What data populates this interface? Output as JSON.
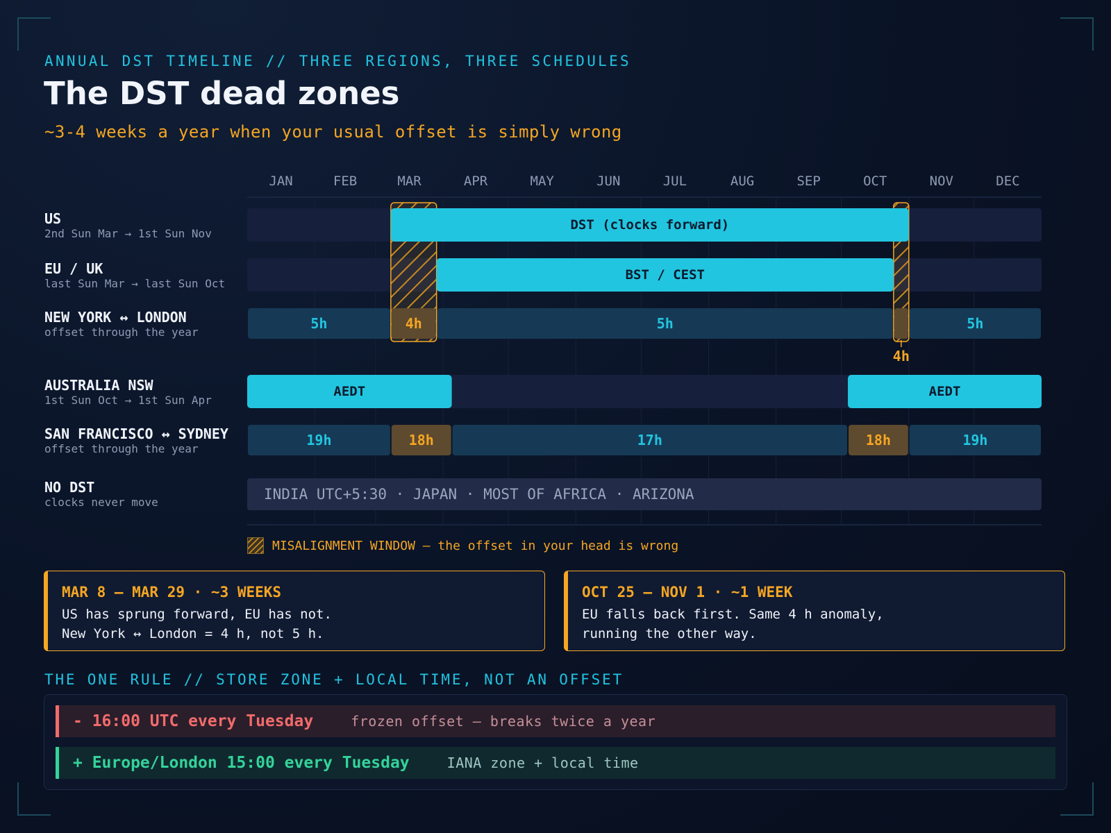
{
  "header": {
    "kicker": "ANNUAL DST TIMELINE // THREE REGIONS, THREE SCHEDULES",
    "title": "The DST dead zones",
    "subtitle": "~3-4 weeks a year when your usual offset is simply wrong"
  },
  "months": [
    "JAN",
    "FEB",
    "MAR",
    "APR",
    "MAY",
    "JUN",
    "JUL",
    "AUG",
    "SEP",
    "OCT",
    "NOV",
    "DEC"
  ],
  "rows": [
    {
      "name": "US",
      "desc": "2nd Sun Mar → 1st Sun Nov"
    },
    {
      "name": "EU / UK",
      "desc": "last Sun Mar → last Sun Oct"
    },
    {
      "name": "NEW YORK ↔ LONDON",
      "desc": "offset through the year"
    },
    {
      "name": "AUSTRALIA NSW",
      "desc": "1st Sun Oct → 1st Sun Apr"
    },
    {
      "name": "SAN FRANCISCO ↔ SYDNEY",
      "desc": "offset through the year"
    },
    {
      "name": "NO DST",
      "desc": "clocks never move"
    }
  ],
  "bars": {
    "us": {
      "label": "DST (clocks forward)",
      "start": "Mar 8",
      "end": "Nov 1"
    },
    "eu": {
      "label": "BST / CEST",
      "start": "Mar 29",
      "end": "Oct 25"
    },
    "aus": {
      "label": "AEDT",
      "periods": [
        {
          "start": "Jan 1",
          "end": "Apr 5"
        },
        {
          "start": "Oct 4",
          "end": "Dec 31"
        }
      ]
    },
    "nodst": {
      "label": "INDIA UTC+5:30 · JAPAN · MOST OF AFRICA · ARIZONA"
    }
  },
  "ny_london_offsets": [
    {
      "label": "5h",
      "start": "Jan 1",
      "end": "Mar 8",
      "anomaly": false
    },
    {
      "label": "4h",
      "start": "Mar 8",
      "end": "Mar 29",
      "anomaly": true
    },
    {
      "label": "5h",
      "start": "Mar 29",
      "end": "Oct 25",
      "anomaly": false
    },
    {
      "label": "4h",
      "start": "Oct 25",
      "end": "Nov 1",
      "anomaly": true
    },
    {
      "label": "5h",
      "start": "Nov 1",
      "end": "Dec 31",
      "anomaly": false
    }
  ],
  "sf_sydney_offsets": [
    {
      "label": "19h",
      "start": "Jan 1",
      "end": "Mar 8",
      "anomaly": false
    },
    {
      "label": "18h",
      "start": "Mar 8",
      "end": "Apr 5",
      "anomaly": true
    },
    {
      "label": "17h",
      "start": "Apr 5",
      "end": "Oct 4",
      "anomaly": false
    },
    {
      "label": "18h",
      "start": "Oct 4",
      "end": "Nov 1",
      "anomaly": true
    },
    {
      "label": "19h",
      "start": "Nov 1",
      "end": "Dec 31",
      "anomaly": false
    }
  ],
  "misalignment_windows": [
    {
      "start": "Mar 8",
      "end": "Mar 29"
    },
    {
      "start": "Oct 25",
      "end": "Nov 1"
    }
  ],
  "legend": {
    "label": "MISALIGNMENT WINDOW — the offset in your head is wrong"
  },
  "callouts": [
    {
      "heading": "MAR 8 — MAR 29 · ~3 WEEKS",
      "lines": [
        "US has sprung forward, EU has not.",
        "New York ↔ London = 4 h, not 5 h."
      ]
    },
    {
      "heading": "OCT 25 — NOV 1 · ~1 WEEK",
      "lines": [
        "EU falls back first. Same 4 h anomaly,",
        "running the other way."
      ]
    }
  ],
  "rule": {
    "title": "THE ONE RULE // STORE ZONE + LOCAL TIME, NOT AN OFFSET",
    "bad": {
      "code": "- 16:00 UTC every Tuesday",
      "note": "frozen offset — breaks twice a year"
    },
    "good": {
      "code": "+ Europe/London 15:00 every Tuesday",
      "note": "IANA zone + local time"
    }
  },
  "colors": {
    "dst": "#22c5e0",
    "track": "#161f3b",
    "offset": "#163a56",
    "offset_text": "#22c5e0",
    "anomaly": "#5e4a2e",
    "anomaly_text": "#f5a623",
    "accent": "#f5a623",
    "nodst": "#222b47",
    "nodst_text": "#9aa6be"
  }
}
